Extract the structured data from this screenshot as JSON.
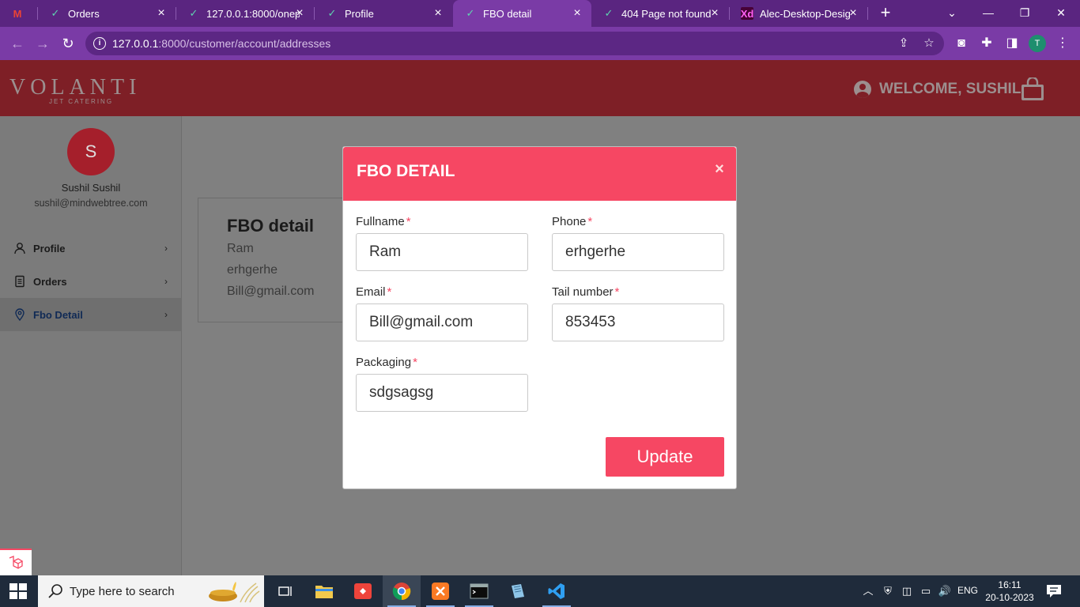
{
  "browser": {
    "tabs": [
      {
        "title": "",
        "favicon": "gmail-icon",
        "active": false
      },
      {
        "title": "Orders",
        "favicon": "check-icon",
        "active": false
      },
      {
        "title": "127.0.0.1:8000/onep",
        "favicon": "check-icon",
        "active": false
      },
      {
        "title": "Profile",
        "favicon": "check-icon",
        "active": false
      },
      {
        "title": "FBO detail",
        "favicon": "check-icon",
        "active": true
      },
      {
        "title": "404 Page not found",
        "favicon": "check-icon",
        "active": false
      },
      {
        "title": "Alec-Desktop-Desig",
        "favicon": "xd-icon",
        "active": false
      }
    ],
    "address": {
      "host": "127.0.0.1",
      "path": ":8000/customer/account/addresses"
    },
    "profile_initial": "T",
    "theme_color": "#7a3ba6"
  },
  "header": {
    "logo_text": "VOLANTI",
    "logo_subtext": "JET CATERING",
    "welcome_text": "WELCOME, SUSHIL",
    "brand_color": "#7e1f26"
  },
  "sidebar": {
    "avatar_initial": "S",
    "user_name": "Sushil Sushil",
    "user_email": "sushil@mindwebtree.com",
    "items": [
      {
        "label": "Profile",
        "icon": "person-icon"
      },
      {
        "label": "Orders",
        "icon": "document-icon"
      },
      {
        "label": "Fbo Detail",
        "icon": "location-pin-icon",
        "active": true
      }
    ]
  },
  "content": {
    "card_title": "FBO detail",
    "lines": [
      "Ram",
      "erhgerhe",
      "Bill@gmail.com"
    ]
  },
  "modal": {
    "title": "FBO DETAIL",
    "close_symbol": "×",
    "required_marker": "*",
    "fields": {
      "fullname": {
        "label": "Fullname",
        "value": "Ram"
      },
      "phone": {
        "label": "Phone",
        "value": "erhgerhe"
      },
      "email": {
        "label": "Email",
        "value": "Bill@gmail.com"
      },
      "tail_number": {
        "label": "Tail number",
        "value": "853453"
      },
      "packaging": {
        "label": "Packaging",
        "value": "sdgsagsg"
      }
    },
    "submit_label": "Update",
    "accent_color": "#f64763"
  },
  "taskbar": {
    "search_placeholder": "Type here to search",
    "language": "ENG",
    "time": "16:11",
    "date": "20-10-2023"
  }
}
